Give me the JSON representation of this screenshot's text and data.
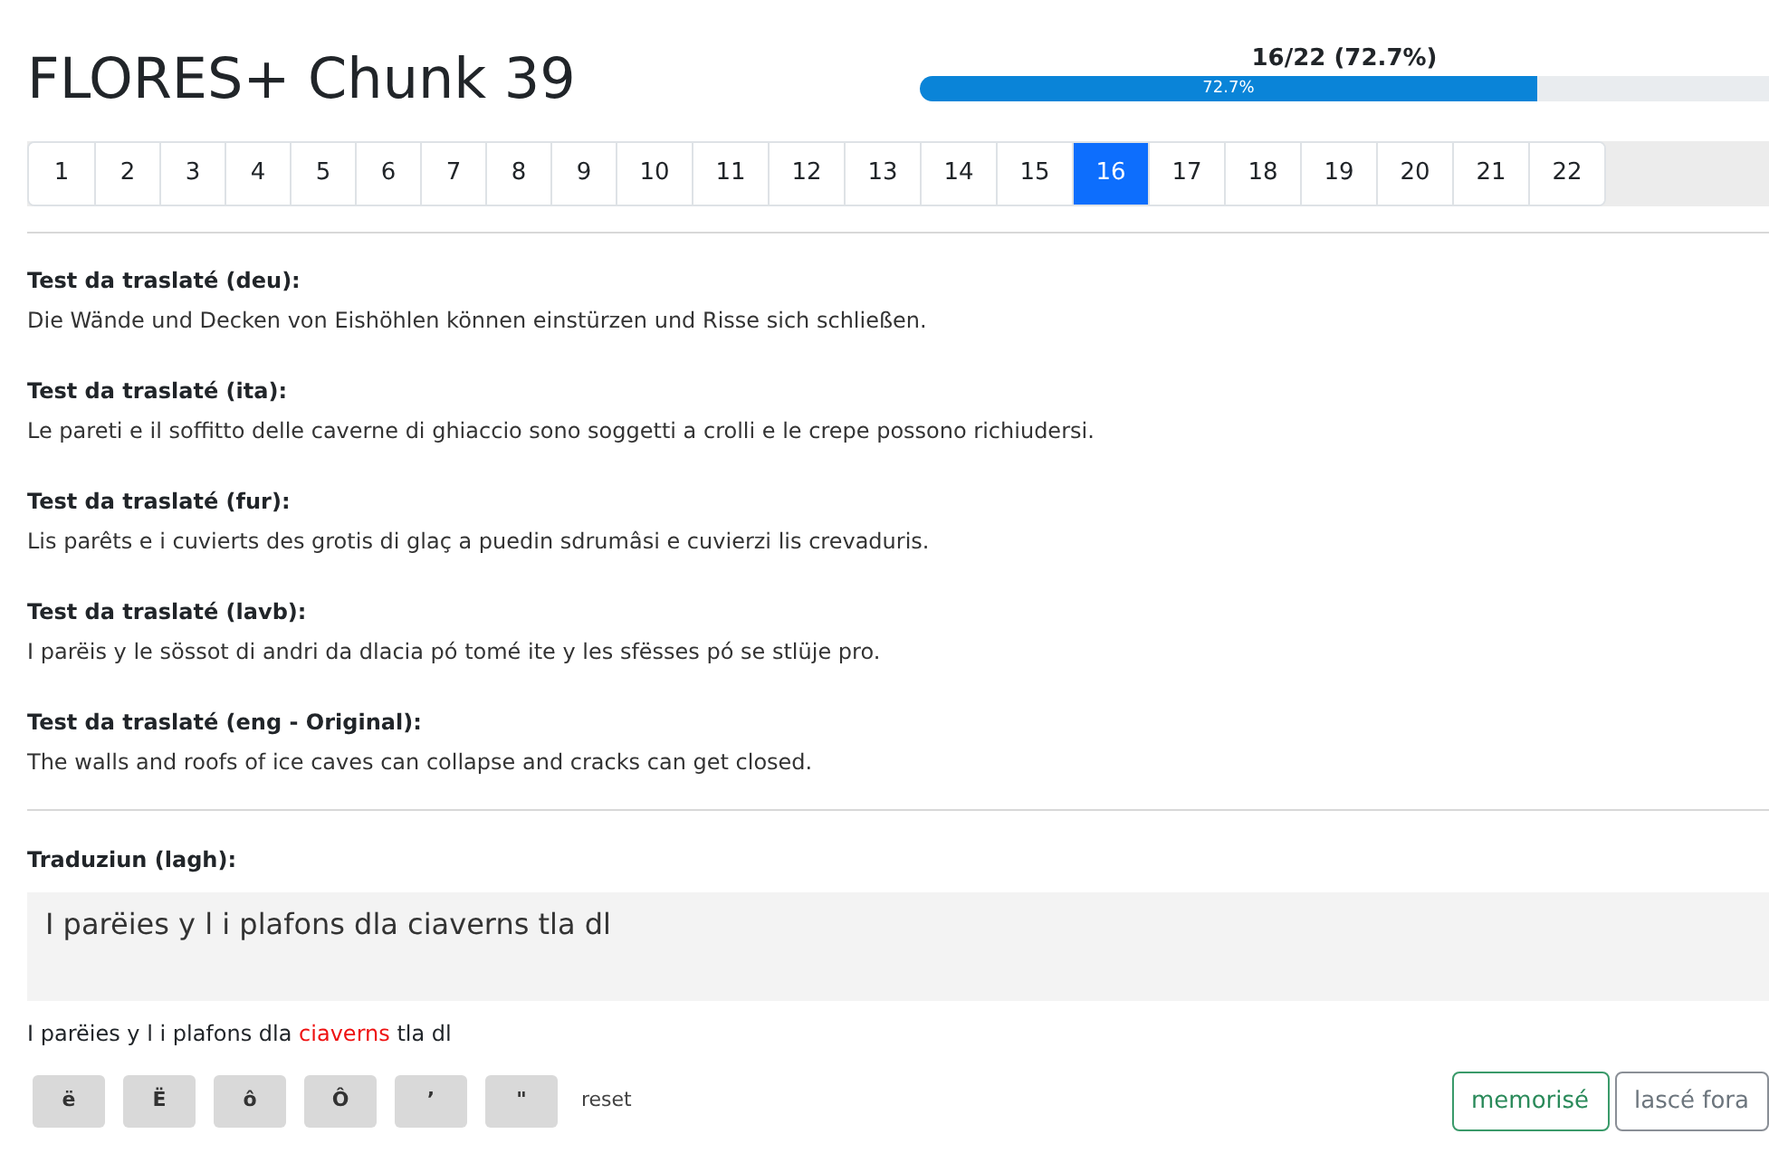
{
  "title": "FLORES+ Chunk 39",
  "progress": {
    "caption": "16/22 (72.7%)",
    "bar_label": "72.7%",
    "level": 0.727
  },
  "pages": [
    {
      "label": "1",
      "selected": false
    },
    {
      "label": "2",
      "selected": false
    },
    {
      "label": "3",
      "selected": false
    },
    {
      "label": "4",
      "selected": false
    },
    {
      "label": "5",
      "selected": false
    },
    {
      "label": "6",
      "selected": false
    },
    {
      "label": "7",
      "selected": false
    },
    {
      "label": "8",
      "selected": false
    },
    {
      "label": "9",
      "selected": false
    },
    {
      "label": "10",
      "selected": false
    },
    {
      "label": "11",
      "selected": false
    },
    {
      "label": "12",
      "selected": false
    },
    {
      "label": "13",
      "selected": false
    },
    {
      "label": "14",
      "selected": false
    },
    {
      "label": "15",
      "selected": false
    },
    {
      "label": "16",
      "selected": true
    },
    {
      "label": "17",
      "selected": false
    },
    {
      "label": "18",
      "selected": false
    },
    {
      "label": "19",
      "selected": false
    },
    {
      "label": "20",
      "selected": false
    },
    {
      "label": "21",
      "selected": false
    },
    {
      "label": "22",
      "selected": false
    }
  ],
  "sources": [
    {
      "label": "Test da traslaté (deu):",
      "text": "Die Wände und Decken von Eishöhlen können einstürzen und Risse sich schließen."
    },
    {
      "label": "Test da traslaté (ita):",
      "text": "Le pareti e il soffitto delle caverne di ghiaccio sono soggetti a crolli e le crepe possono richiudersi."
    },
    {
      "label": "Test da traslaté (fur):",
      "text": "Lis parêts e i cuvierts des grotis di glaç a puedin sdrumâsi e cuvierzi lis crevaduris."
    },
    {
      "label": "Test da traslaté (lavb):",
      "text": "I parëis y le sössot di andri da dlacia pó tomé ite y les sfësses pó se stlüje pro."
    },
    {
      "label": "Test da traslaté (eng - Original):",
      "text": "The walls and roofs of ice caves can collapse and cracks can get closed."
    }
  ],
  "translation": {
    "label": "Traduziun (lagh):",
    "value": "I parëies y l i plafons dla ciaverns tla dl"
  },
  "preview": [
    {
      "text": "I parëies y l i plafons dla ",
      "error": false
    },
    {
      "text": "ciaverns",
      "error": true
    },
    {
      "text": " tla dl",
      "error": false
    }
  ],
  "char_buttons": [
    "ë",
    "Ë",
    "ô",
    "Ô",
    "ʼ",
    "\""
  ],
  "reset": "reset",
  "actions": [
    {
      "label": "memorisé",
      "kind": "success"
    },
    {
      "label": "lascé fora",
      "kind": "secondary"
    }
  ]
}
